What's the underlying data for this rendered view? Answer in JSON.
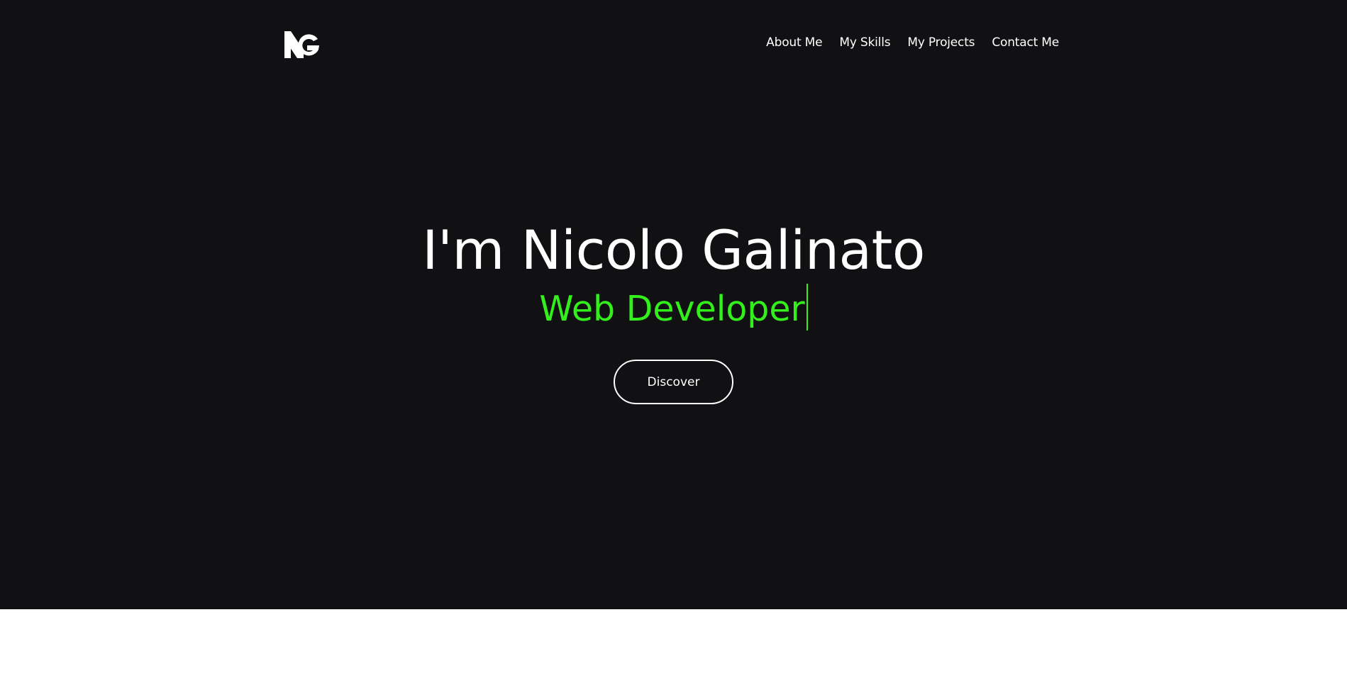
{
  "nav": {
    "items": [
      {
        "label": "About Me"
      },
      {
        "label": "My Skills"
      },
      {
        "label": "My Projects"
      },
      {
        "label": "Contact Me"
      }
    ]
  },
  "hero": {
    "title": "I'm Nicolo Galinato",
    "subtitle": "Web Developer",
    "discover_label": "Discover"
  },
  "colors": {
    "hero_background": "#111113",
    "accent": "#33f01d",
    "text": "#ffffff",
    "page_background": "#ffffff"
  },
  "icons": {
    "logo": "ng-monogram-logo"
  }
}
